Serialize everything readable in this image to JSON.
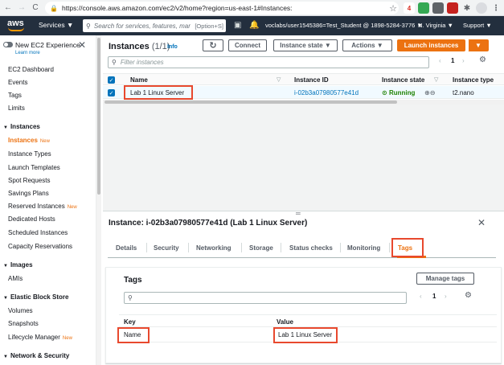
{
  "browser": {
    "url": "https://console.aws.amazon.com/ec2/v2/home?region=us-east-1#Instances:",
    "ext_badge": "4"
  },
  "header": {
    "logo": "aws",
    "services_label": "Services ▼",
    "search_placeholder": "Search for services, features, mar",
    "search_shortcut": "[Option+S]",
    "account": "voclabs/user1545386=Test_Student @ 1898-5284-3776 ▼",
    "region": "N. Virginia ▼",
    "support": "Support ▼"
  },
  "sidebar": {
    "new_experience": "New EC2 Experience",
    "learn_more": "Learn more",
    "new_badge": "New",
    "items": {
      "ec2_dashboard": "EC2 Dashboard",
      "events": "Events",
      "tags": "Tags",
      "limits": "Limits",
      "instances_section": "Instances",
      "instances": "Instances",
      "instance_types": "Instance Types",
      "launch_templates": "Launch Templates",
      "spot_requests": "Spot Requests",
      "savings_plans": "Savings Plans",
      "reserved_instances": "Reserved Instances",
      "dedicated_hosts": "Dedicated Hosts",
      "scheduled_instances": "Scheduled Instances",
      "capacity_reservations": "Capacity Reservations",
      "images_section": "Images",
      "amis": "AMIs",
      "ebs_section": "Elastic Block Store",
      "volumes": "Volumes",
      "snapshots": "Snapshots",
      "lifecycle_manager": "Lifecycle Manager",
      "network_section": "Network & Security"
    }
  },
  "instances": {
    "title": "Instances",
    "count": "(1/1)",
    "info": "Info",
    "refresh_icon": "↻",
    "connect": "Connect",
    "instance_state": "Instance state ▼",
    "actions": "Actions ▼",
    "launch": "Launch instances",
    "launch_caret": "▼",
    "filter_placeholder": "Filter instances",
    "page": "1",
    "columns": {
      "name": "Name",
      "instance_id": "Instance ID",
      "instance_state": "Instance state",
      "instance_type": "Instance type"
    },
    "rows": [
      {
        "name": "Lab 1 Linux Server",
        "instance_id": "i-02b3a07980577e41d",
        "state": "Running",
        "type": "t2.nano"
      }
    ]
  },
  "detail": {
    "title": "Instance: i-02b3a07980577e41d (Lab 1 Linux Server)",
    "tabs": {
      "details": "Details",
      "security": "Security",
      "networking": "Networking",
      "storage": "Storage",
      "status_checks": "Status checks",
      "monitoring": "Monitoring",
      "tags": "Tags"
    },
    "tags_heading": "Tags",
    "manage_tags": "Manage tags",
    "page": "1",
    "key_header": "Key",
    "value_header": "Value",
    "tag_rows": [
      {
        "key": "Name",
        "value": "Lab 1 Linux Server"
      }
    ]
  },
  "colors": {
    "aws_header": "#232f3e",
    "accent_orange": "#ec7211",
    "link_blue": "#0073bb",
    "running_green": "#1d8102",
    "annotation_red": "#e8492e"
  }
}
